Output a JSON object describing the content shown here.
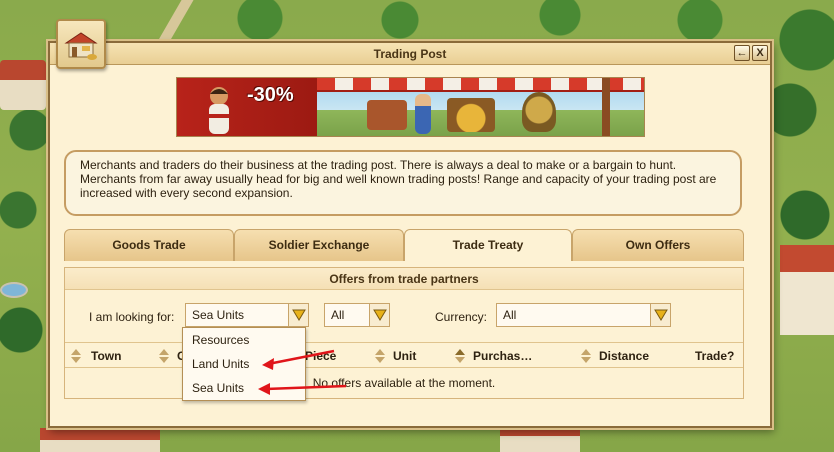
{
  "window": {
    "title": "Trading Post",
    "back_label": "←",
    "close_label": "X"
  },
  "banner": {
    "discount": "-30%"
  },
  "description": "Merchants and traders do their business at the trading post. There is always a deal to make or a bargain to hunt. Merchants from far away usually head for big and well known trading posts! Range and capacity of your trading post are increased with every second expansion.",
  "tabs": [
    {
      "label": "Goods Trade",
      "active": false
    },
    {
      "label": "Soldier Exchange",
      "active": false
    },
    {
      "label": "Trade Treaty",
      "active": true
    },
    {
      "label": "Own Offers",
      "active": false
    }
  ],
  "panel": {
    "heading": "Offers from trade partners",
    "looking_label": "I am looking for:",
    "looking_value": "Sea Units",
    "second_value": "All",
    "currency_label": "Currency:",
    "currency_value": "All",
    "columns": [
      "Town",
      "C",
      "Piece",
      "Unit",
      "Purchas…",
      "Distance",
      "Trade?"
    ],
    "empty_message": "No offers available at the moment."
  },
  "dropdown": {
    "options": [
      "Resources",
      "Land Units",
      "Sea Units"
    ]
  },
  "colors": {
    "annotation_arrow": "#e0151a",
    "window_bg": "#fdf2d4",
    "border": "#8a6b3a"
  }
}
